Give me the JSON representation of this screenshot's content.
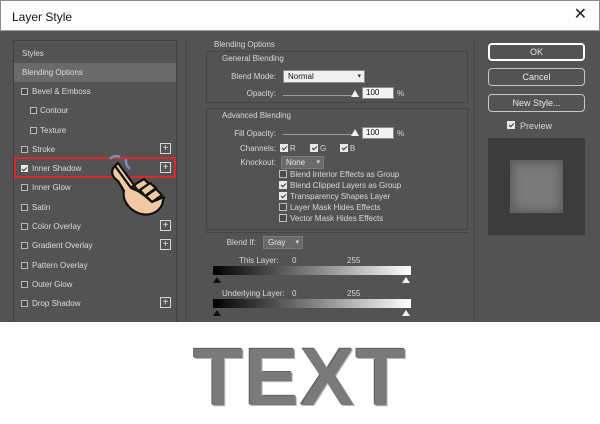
{
  "window": {
    "title": "Layer Style",
    "close_glyph": "✕"
  },
  "styles_panel": {
    "items": [
      {
        "label": "Styles",
        "kind": "head",
        "checked": null,
        "plus": false,
        "active": false
      },
      {
        "label": "Blending Options",
        "kind": "head",
        "checked": null,
        "plus": false,
        "active": true
      },
      {
        "label": "Bevel & Emboss",
        "kind": "item",
        "checked": false,
        "plus": false,
        "active": false
      },
      {
        "label": "Contour",
        "kind": "sub",
        "checked": false,
        "plus": false,
        "active": false
      },
      {
        "label": "Texture",
        "kind": "sub",
        "checked": false,
        "plus": false,
        "active": false
      },
      {
        "label": "Stroke",
        "kind": "item",
        "checked": false,
        "plus": true,
        "active": false
      },
      {
        "label": "Inner Shadow",
        "kind": "item",
        "checked": true,
        "plus": true,
        "active": false
      },
      {
        "label": "Inner Glow",
        "kind": "item",
        "checked": false,
        "plus": false,
        "active": false
      },
      {
        "label": "Satin",
        "kind": "item",
        "checked": false,
        "plus": false,
        "active": false
      },
      {
        "label": "Color Overlay",
        "kind": "item",
        "checked": false,
        "plus": true,
        "active": false
      },
      {
        "label": "Gradient Overlay",
        "kind": "item",
        "checked": false,
        "plus": true,
        "active": false
      },
      {
        "label": "Pattern Overlay",
        "kind": "item",
        "checked": false,
        "plus": false,
        "active": false
      },
      {
        "label": "Outer Glow",
        "kind": "item",
        "checked": false,
        "plus": false,
        "active": false
      },
      {
        "label": "Drop Shadow",
        "kind": "item",
        "checked": false,
        "plus": true,
        "active": false
      }
    ],
    "plus_glyph": "+",
    "highlight_color": "#d9292a"
  },
  "options": {
    "section_title": "Blending Options",
    "general": {
      "title": "General Blending",
      "blend_mode_label": "Blend Mode:",
      "blend_mode_value": "Normal",
      "opacity_label": "Opacity:",
      "opacity_value": "100",
      "opacity_unit": "%",
      "opacity_level": 1.0
    },
    "advanced": {
      "title": "Advanced Blending",
      "fill_opacity_label": "Fill Opacity:",
      "fill_opacity_value": "100",
      "fill_opacity_unit": "%",
      "fill_opacity_level": 1.0,
      "channels_label": "Channels:",
      "channels": [
        {
          "label": "R",
          "checked": true
        },
        {
          "label": "G",
          "checked": true
        },
        {
          "label": "B",
          "checked": true
        }
      ],
      "knockout_label": "Knockout:",
      "knockout_value": "None",
      "checkboxes": [
        {
          "label": "Blend Interior Effects as Group",
          "checked": false
        },
        {
          "label": "Blend Clipped Layers as Group",
          "checked": true
        },
        {
          "label": "Transparency Shapes Layer",
          "checked": true
        },
        {
          "label": "Layer Mask Hides Effects",
          "checked": false
        },
        {
          "label": "Vector Mask Hides Effects",
          "checked": false
        }
      ]
    },
    "blend_if": {
      "label": "Blend If:",
      "value": "Gray",
      "this_layer_label": "This Layer:",
      "this_layer_min": "0",
      "this_layer_max": "255",
      "underlying_label": "Underlying Layer:",
      "underlying_min": "0",
      "underlying_max": "255"
    }
  },
  "buttons": {
    "ok": "OK",
    "cancel": "Cancel",
    "new_style": "New Style...",
    "preview_label": "Preview",
    "preview_checked": true
  },
  "caption": {
    "text": "TEXT"
  },
  "icons": {
    "cursor": "hand-pointer-icon",
    "caret": "▾",
    "check": "check-icon"
  }
}
